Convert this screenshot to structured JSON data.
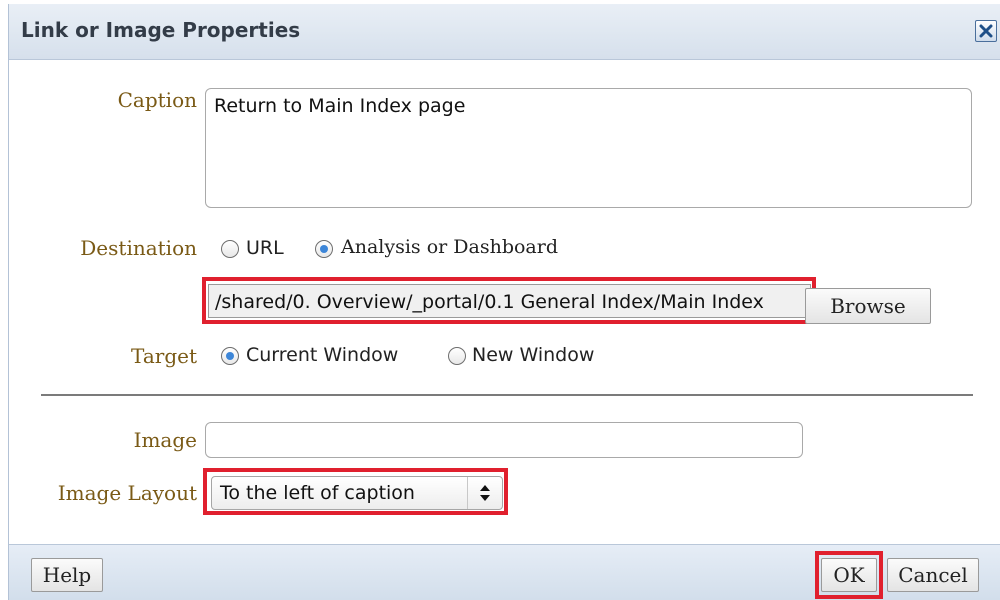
{
  "dialog": {
    "title": "Link or Image Properties",
    "close_icon": "close-icon"
  },
  "caption": {
    "label": "Caption",
    "value": "Return to Main Index page"
  },
  "destination": {
    "label": "Destination",
    "options": [
      "URL",
      "Analysis or Dashboard"
    ],
    "selected": "Analysis or Dashboard",
    "path_value": "/shared/0. Overview/_portal/0.1 General Index/Main Index",
    "browse_label": "Browse"
  },
  "target": {
    "label": "Target",
    "options": [
      "Current Window",
      "New Window"
    ],
    "selected": "Current Window"
  },
  "image": {
    "label": "Image",
    "value": ""
  },
  "image_layout": {
    "label": "Image Layout",
    "selected": "To the left of caption"
  },
  "footer": {
    "help_label": "Help",
    "ok_label": "OK",
    "cancel_label": "Cancel"
  },
  "colors": {
    "highlight": "#e0202e",
    "label_text": "#7a5a16",
    "radio_selected": "#3d86d8"
  }
}
